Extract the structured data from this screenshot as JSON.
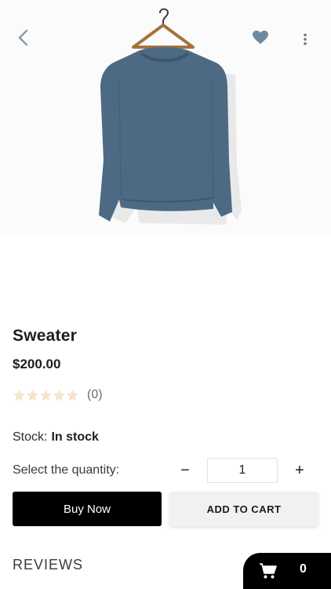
{
  "header": {
    "back_icon": "chevron-left-icon",
    "favorite_icon": "heart-icon",
    "more_icon": "more-vertical-icon"
  },
  "product": {
    "image": "blue-sweater-on-hanger",
    "title": "Sweater",
    "price": "$200.00",
    "rating_value": 0,
    "rating_max": 5,
    "rating_count": "(0)",
    "stock_label": "Stock:",
    "stock_value": "In stock"
  },
  "quantity": {
    "label": "Select the quantity:",
    "value": "1",
    "minus": "−",
    "plus": "+"
  },
  "actions": {
    "buy_now": "Buy Now",
    "add_to_cart": "ADD TO CART"
  },
  "reviews": {
    "heading": "REVIEWS"
  },
  "cart": {
    "icon": "cart-icon",
    "count": "0"
  },
  "colors": {
    "primary": "#000000",
    "star_empty": "#f6e3cc",
    "heart": "#6c8aa0",
    "sweater": "#4d6a84"
  }
}
